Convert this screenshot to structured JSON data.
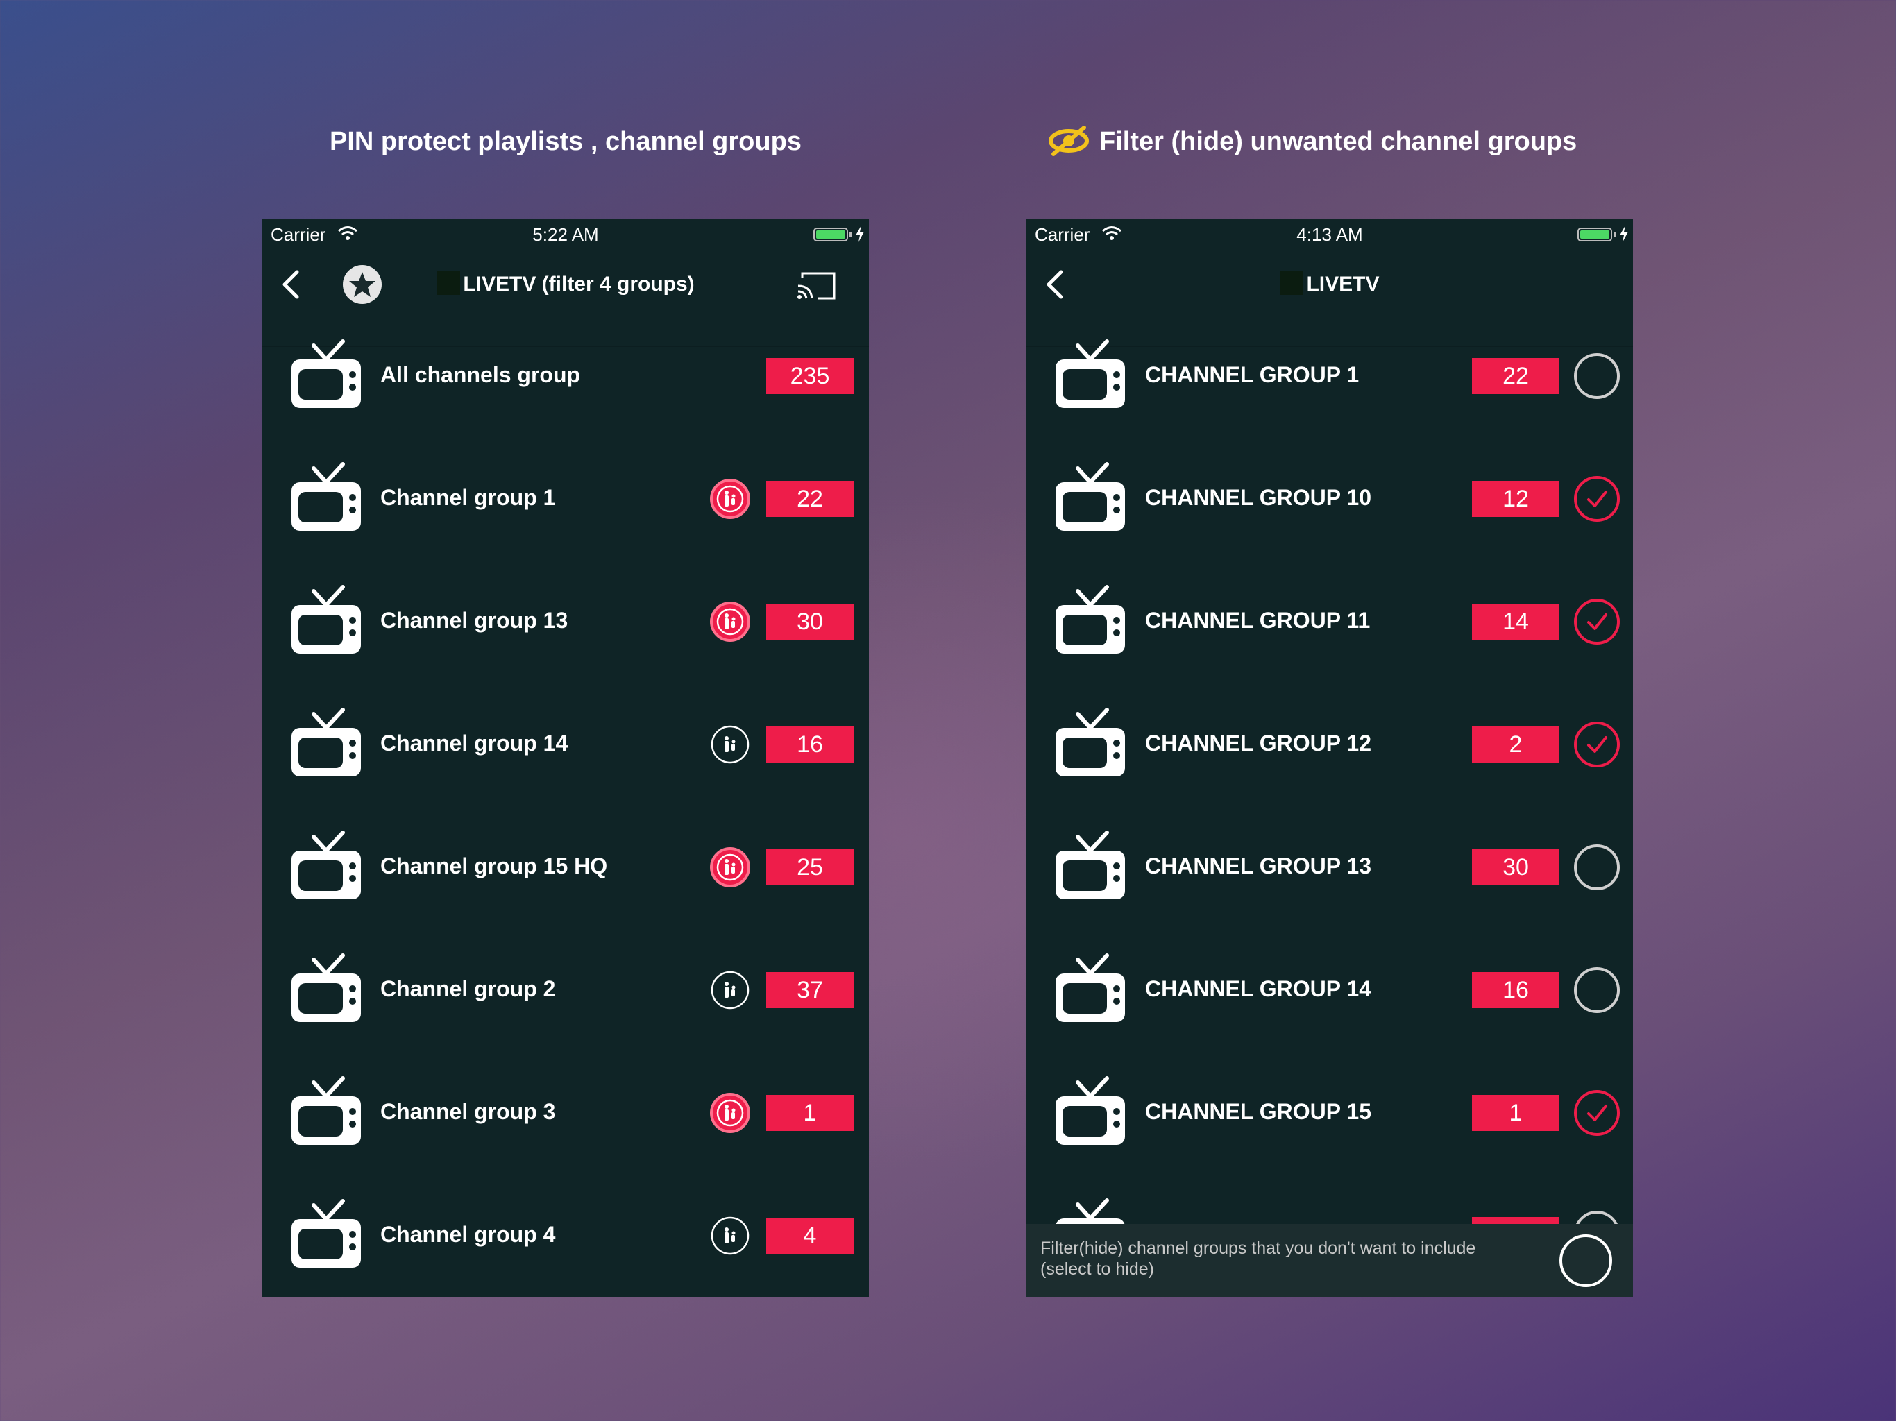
{
  "captions": {
    "left": "PIN protect playlists , channel groups",
    "right": "Filter (hide) unwanted channel groups"
  },
  "colors": {
    "accent": "#ee1d4a",
    "panel": "#0f2426",
    "eye": "#f2c21b"
  },
  "left_screen": {
    "status": {
      "carrier": "Carrier",
      "time": "5:22 AM"
    },
    "title": "LIVETV (filter 4 groups)",
    "rows": [
      {
        "label": "All channels group",
        "count": "235",
        "parental": "none"
      },
      {
        "label": "Channel group 1",
        "count": "22",
        "parental": "on"
      },
      {
        "label": "Channel group 13",
        "count": "30",
        "parental": "on"
      },
      {
        "label": "Channel group 14",
        "count": "16",
        "parental": "off"
      },
      {
        "label": "Channel group 15 HQ",
        "count": "25",
        "parental": "on"
      },
      {
        "label": "Channel group 2",
        "count": "37",
        "parental": "off"
      },
      {
        "label": "Channel group 3",
        "count": "1",
        "parental": "on"
      },
      {
        "label": "Channel group 4",
        "count": "4",
        "parental": "off"
      }
    ]
  },
  "right_screen": {
    "status": {
      "carrier": "Carrier",
      "time": "4:13 AM"
    },
    "title": "LIVETV",
    "rows": [
      {
        "label": "CHANNEL GROUP 1",
        "count": "22",
        "hidden": false
      },
      {
        "label": "CHANNEL GROUP 10",
        "count": "12",
        "hidden": true
      },
      {
        "label": "CHANNEL GROUP 11",
        "count": "14",
        "hidden": true
      },
      {
        "label": "CHANNEL GROUP 12",
        "count": "2",
        "hidden": true
      },
      {
        "label": "CHANNEL GROUP 13",
        "count": "30",
        "hidden": false
      },
      {
        "label": "CHANNEL GROUP 14",
        "count": "16",
        "hidden": false
      },
      {
        "label": "CHANNEL GROUP 15",
        "count": "1",
        "hidden": true
      }
    ],
    "footer_text": "Filter(hide) channel groups that you don't want to include (select to hide)"
  }
}
